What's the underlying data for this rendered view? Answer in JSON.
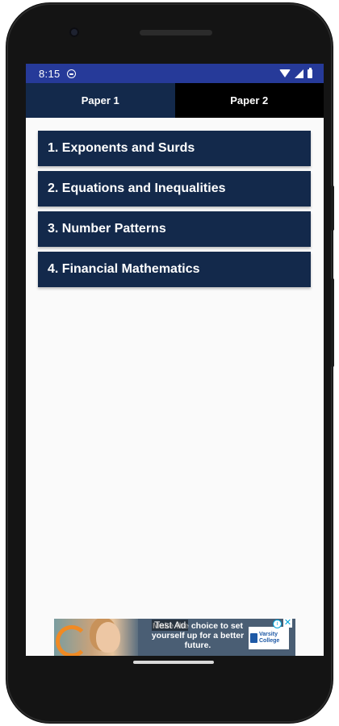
{
  "status_bar": {
    "time": "8:15"
  },
  "tabs": [
    {
      "label": "Paper 1",
      "active": true
    },
    {
      "label": "Paper 2",
      "active": false
    }
  ],
  "topics": [
    {
      "label": "1. Exponents and Surds"
    },
    {
      "label": "2. Equations and Inequalities"
    },
    {
      "label": "3. Number Patterns"
    },
    {
      "label": "4. Financial Mathematics"
    }
  ],
  "ad": {
    "label": "Test Ad",
    "text": "Make the choice to set yourself up for a better future.",
    "brand_line1": "Varsity",
    "brand_line2": "College",
    "info_glyph": "i",
    "close_glyph": "✕"
  },
  "colors": {
    "status_bar": "#263a99",
    "tab_active": "#13294b",
    "tab_inactive": "#000000",
    "topic_bg": "#13294b",
    "content_bg": "#fafafa"
  }
}
